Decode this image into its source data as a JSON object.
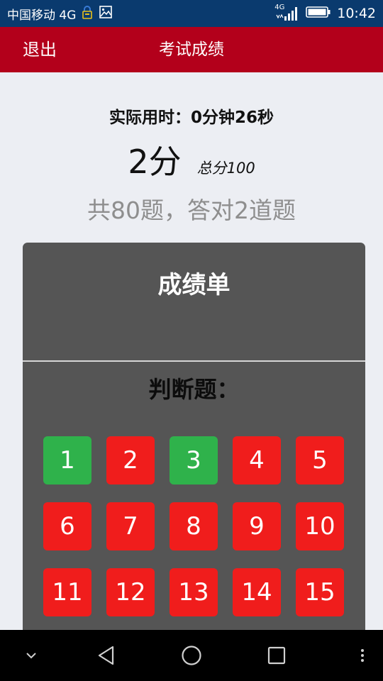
{
  "status_bar": {
    "carrier": "中国移动 4G",
    "network_badge": "4G",
    "time": "10:42",
    "icons": [
      "lock-icon",
      "image-icon",
      "signal-icon",
      "battery-icon"
    ]
  },
  "header": {
    "back_label": "退出",
    "title": "考试成绩"
  },
  "result": {
    "time_used": "实际用时：0分钟26秒",
    "score": "2分",
    "total": "总分100",
    "summary": "共80题，答对2道题"
  },
  "card": {
    "title": "成绩单",
    "section_title": "判断题："
  },
  "questions": [
    {
      "label": "1",
      "status": "correct"
    },
    {
      "label": "2",
      "status": "wrong"
    },
    {
      "label": "3",
      "status": "correct"
    },
    {
      "label": "4",
      "status": "wrong"
    },
    {
      "label": "5",
      "status": "wrong"
    },
    {
      "label": "6",
      "status": "wrong"
    },
    {
      "label": "7",
      "status": "wrong"
    },
    {
      "label": "8",
      "status": "wrong"
    },
    {
      "label": "9",
      "status": "wrong"
    },
    {
      "label": "10",
      "status": "wrong"
    },
    {
      "label": "11",
      "status": "wrong"
    },
    {
      "label": "12",
      "status": "wrong"
    },
    {
      "label": "13",
      "status": "wrong"
    },
    {
      "label": "14",
      "status": "wrong"
    },
    {
      "label": "15",
      "status": "wrong"
    }
  ],
  "colors": {
    "correct": "#2fb24b",
    "wrong": "#f01d1c",
    "header": "#b3001b",
    "card": "#555555"
  },
  "nav_bar": {
    "icons": [
      "chevron-down-icon",
      "back-triangle-icon",
      "home-circle-icon",
      "recents-square-icon",
      "more-dots-icon"
    ]
  }
}
